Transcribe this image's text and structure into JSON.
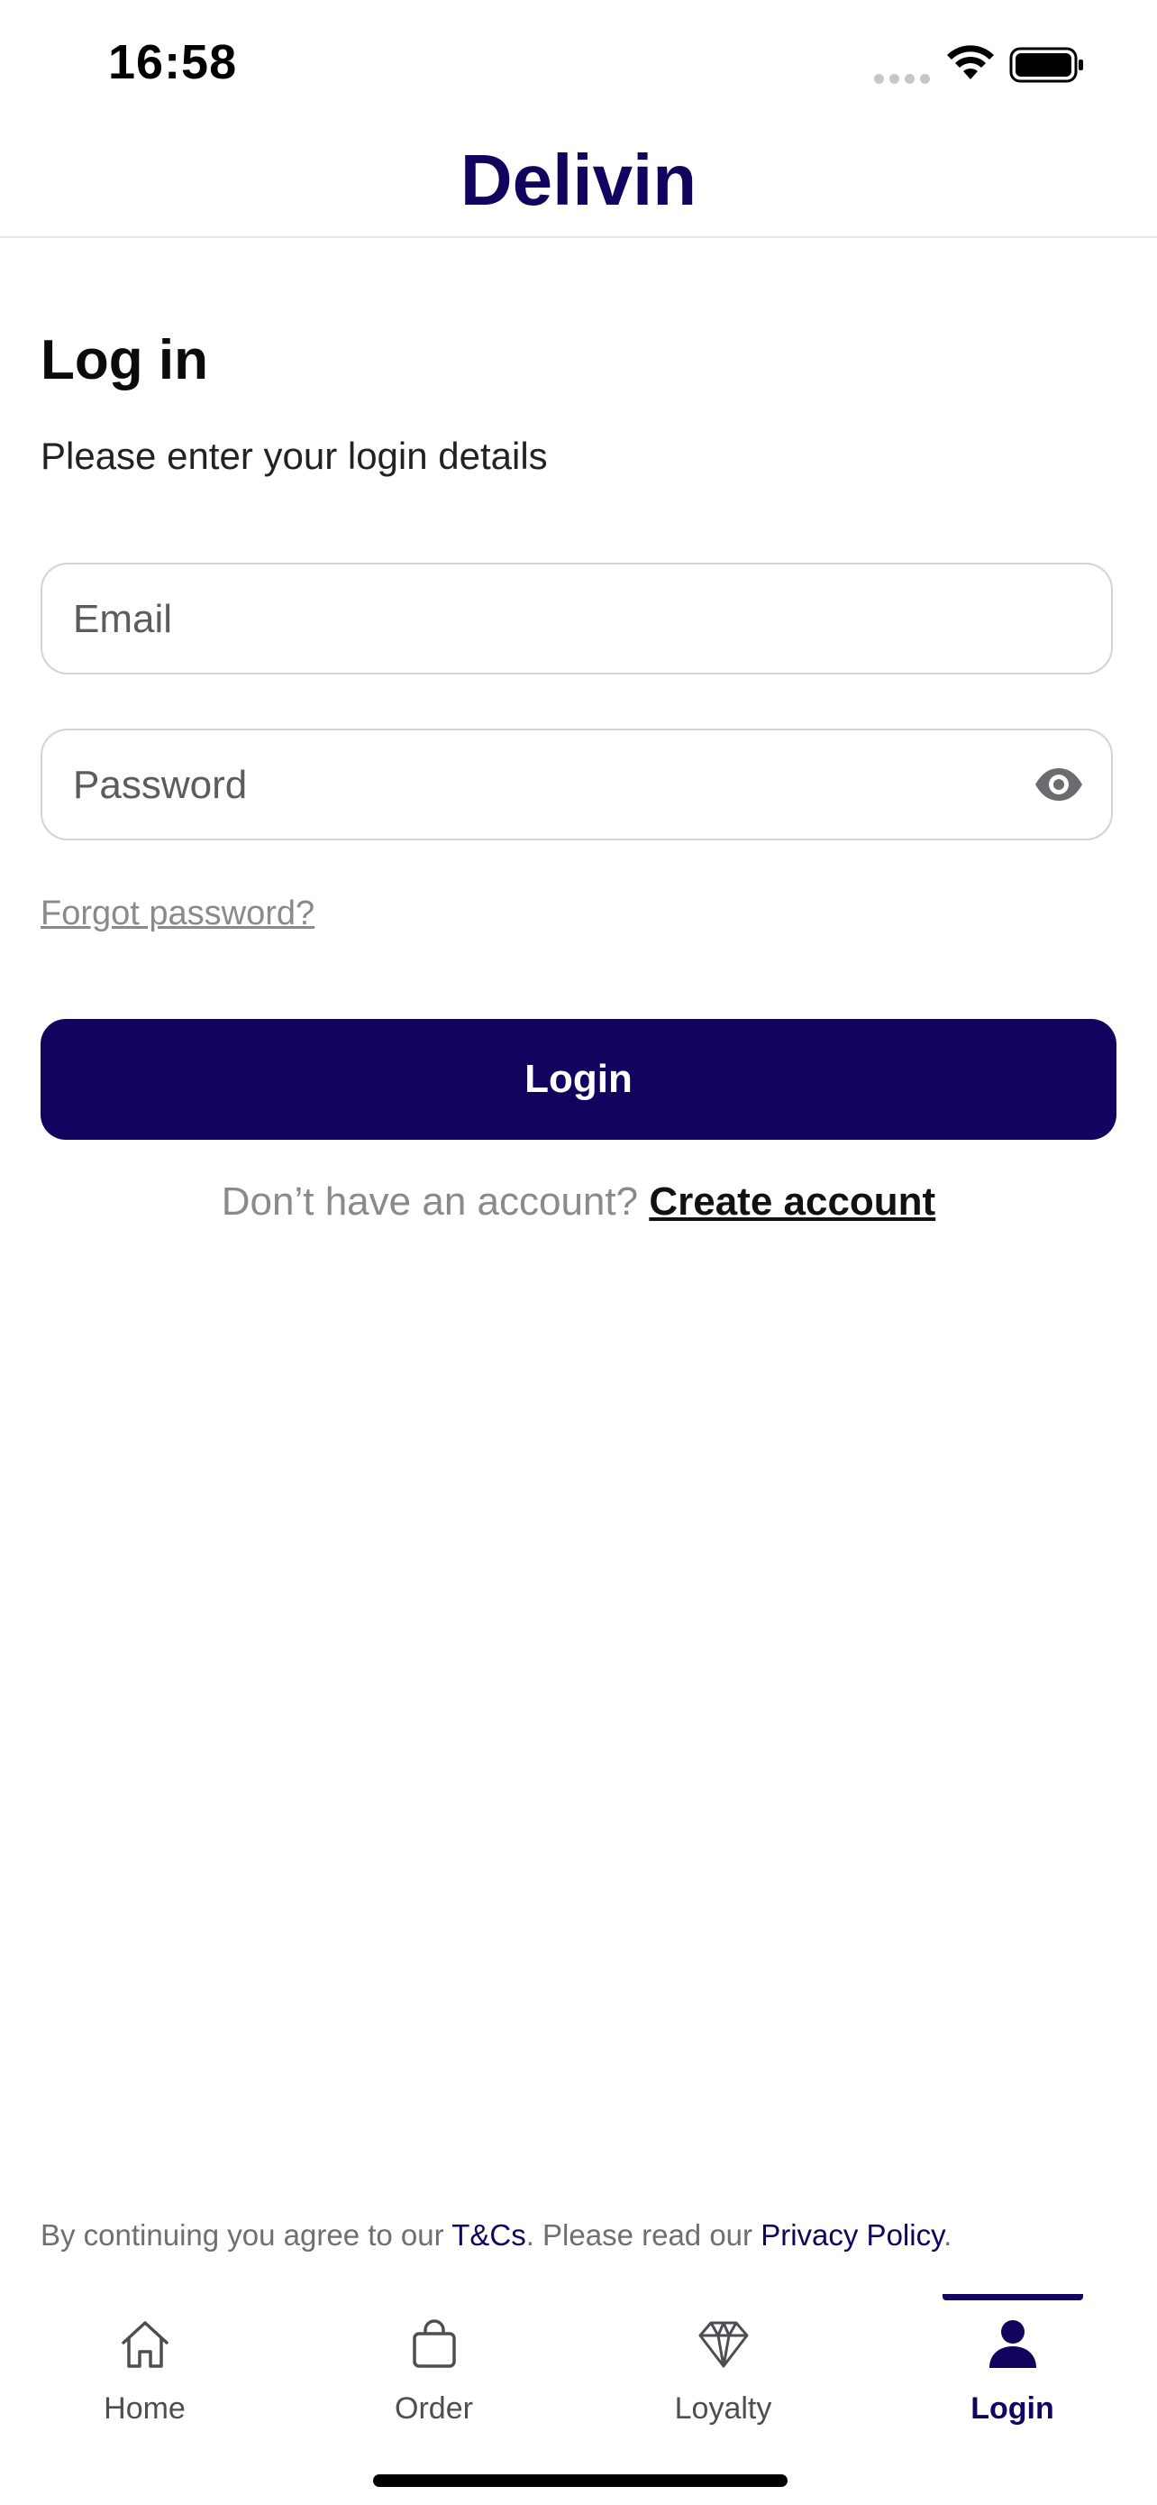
{
  "status_bar": {
    "time": "16:58"
  },
  "header": {
    "brand": "Delivin"
  },
  "login": {
    "title": "Log in",
    "subtitle": "Please enter your login details",
    "email_placeholder": "Email",
    "password_placeholder": "Password",
    "forgot_label": "Forgot password?",
    "submit_label": "Login",
    "no_account_prompt": "Don’t have an account?",
    "create_account_label": "Create account"
  },
  "legal": {
    "prefix": "By continuing you agree to our ",
    "terms_label": "T&Cs",
    "middle": ". Please read our ",
    "privacy_label": "Privacy Policy",
    "suffix": "."
  },
  "tabs": [
    {
      "label": "Home",
      "icon": "home-icon"
    },
    {
      "label": "Order",
      "icon": "bag-icon"
    },
    {
      "label": "Loyalty",
      "icon": "diamond-icon"
    },
    {
      "label": "Login",
      "icon": "person-icon",
      "active": true
    }
  ],
  "colors": {
    "brand": "#12035f",
    "muted_text": "#8a8a8e",
    "field_border": "#d3d3d6"
  }
}
